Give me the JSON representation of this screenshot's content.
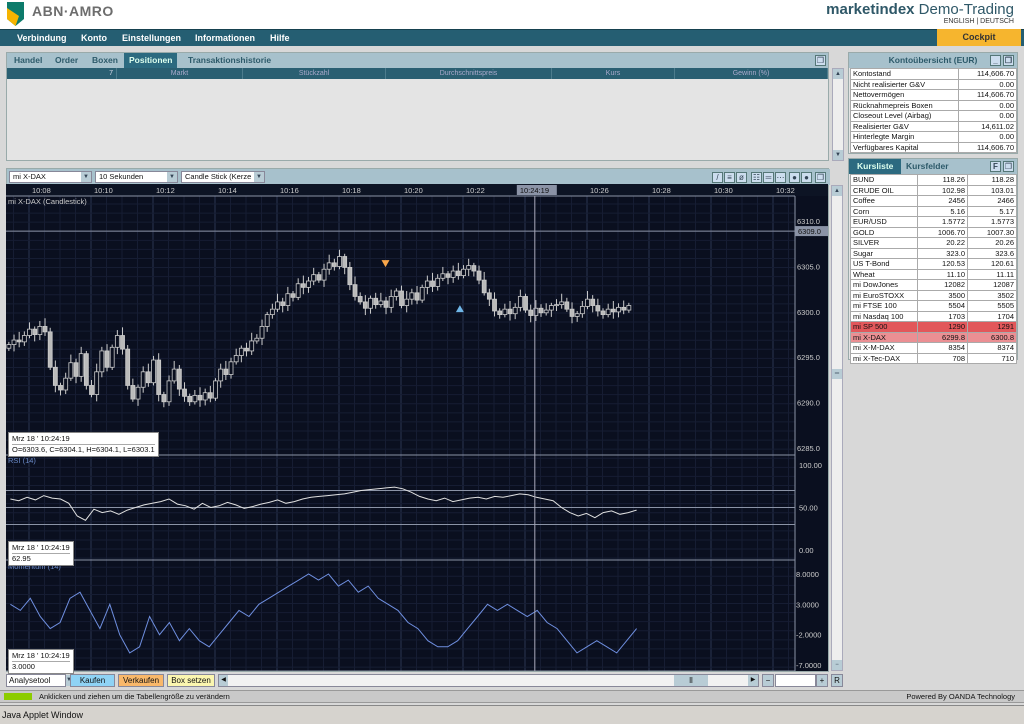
{
  "header": {
    "logo": "ABN·AMRO",
    "brand_bold": "marketindex",
    "brand_rest": " Demo-Trading",
    "lang_en": "ENGLISH",
    "lang_sep": " | ",
    "lang_de": "DEUTSCH"
  },
  "nav": [
    "Verbindung",
    "Konto",
    "Einstellungen",
    "Informationen",
    "Hilfe"
  ],
  "cockpit": "Cockpit",
  "positions": {
    "tabs": [
      "Handel",
      "Order",
      "Boxen",
      "Positionen",
      "Transaktionshistorie"
    ],
    "active": 3,
    "columns": [
      "7",
      "Markt",
      "Stückzahl",
      "Durchschnittspreis",
      "Kurs",
      "Gewinn (%)"
    ]
  },
  "konto": {
    "title": "Kontoübersicht (EUR)",
    "rows": [
      [
        "Kontostand",
        "114,606.70"
      ],
      [
        "Nicht realisierter G&V",
        "0.00"
      ],
      [
        "Nettovermögen",
        "114,606.70"
      ],
      [
        "Rücknahmepreis Boxen",
        "0.00"
      ],
      [
        "Closeout Level (Airbag)",
        "0.00"
      ],
      [
        "Realisierter G&V",
        "14,611.02"
      ],
      [
        "Hinterlegte Margin",
        "0.00"
      ],
      [
        "Verfügbares Kapital",
        "114,606.70"
      ]
    ]
  },
  "kurs": {
    "tabs": [
      "Kursliste",
      "Kursfelder"
    ],
    "f_label": "F",
    "rows": [
      [
        "BUND",
        "118.26",
        "118.28"
      ],
      [
        "CRUDE OIL",
        "102.98",
        "103.01"
      ],
      [
        "Coffee",
        "2456",
        "2466"
      ],
      [
        "Corn",
        "5.16",
        "5.17"
      ],
      [
        "EUR/USD",
        "1.5772",
        "1.5773"
      ],
      [
        "GOLD",
        "1006.70",
        "1007.30"
      ],
      [
        "SILVER",
        "20.22",
        "20.26"
      ],
      [
        "Sugar",
        "323.0",
        "323.6"
      ],
      [
        "US T-Bond",
        "120.53",
        "120.61"
      ],
      [
        "Wheat",
        "11.10",
        "11.11"
      ],
      [
        "mi DowJones",
        "12082",
        "12087"
      ],
      [
        "mi EuroSTOXX",
        "3500",
        "3502"
      ],
      [
        "mi FTSE 100",
        "5504",
        "5505"
      ],
      [
        "mi Nasdaq 100",
        "1703",
        "1704"
      ],
      [
        "mi SP 500",
        "1290",
        "1291"
      ],
      [
        "mi X-DAX",
        "6299.8",
        "6300.8"
      ],
      [
        "mi X-M-DAX",
        "8354",
        "8374"
      ],
      [
        "mi X-Tec-DAX",
        "708",
        "710"
      ]
    ],
    "highlight": {
      "14": "red",
      "15": "pink"
    }
  },
  "chart_controls": {
    "instrument": "mi X-DAX",
    "interval": "10 Sekunden",
    "type": "Candle Stick (Kerze"
  },
  "chart_data": {
    "type": "candlestick",
    "title": "mi X-DAX (Candlestick)",
    "time_ticks": [
      "10:08",
      "10:10",
      "10:12",
      "10:14",
      "10:16",
      "10:18",
      "10:20",
      "10:22",
      "10:26",
      "10:28",
      "10:30",
      "10:32"
    ],
    "crosshair_time": "10:24:19",
    "price_ticks": [
      "6310.0",
      "6305.0",
      "6300.0",
      "6295.0",
      "6290.0",
      "6285.0"
    ],
    "price_range": [
      6284,
      6312
    ],
    "level_label": "6309.0",
    "level": 6309,
    "start_minute": 7.35,
    "interval_seconds": 10,
    "closes": [
      6296.5,
      6297,
      6296.8,
      6297.5,
      6298.2,
      6297.6,
      6298.5,
      6297.9,
      6294,
      6292,
      6291.5,
      6292.8,
      6294.5,
      6293,
      6295.5,
      6292,
      6291,
      6293.5,
      6295.8,
      6294,
      6296.2,
      6297.5,
      6296,
      6292,
      6290.5,
      6291.8,
      6293.5,
      6292.3,
      6294.8,
      6291,
      6290.2,
      6292.5,
      6293.8,
      6291.6,
      6290.8,
      6290.2,
      6290.9,
      6290.4,
      6291.2,
      6290.6,
      6292.5,
      6293.8,
      6293.2,
      6294.6,
      6295.3,
      6296.1,
      6295.8,
      6296.9,
      6297.2,
      6298.5,
      6299.8,
      6300.4,
      6301.2,
      6300.8,
      6302.1,
      6301.7,
      6303.2,
      6302.8,
      6303.5,
      6304.2,
      6303.6,
      6304.8,
      6305.5,
      6305.1,
      6306.2,
      6305.0,
      6303.1,
      6301.8,
      6301.2,
      6300.5,
      6301.6,
      6300.9,
      6301.3,
      6300.6,
      6301.8,
      6302.4,
      6300.8,
      6301.5,
      6302.2,
      6301.4,
      6302.8,
      6303.5,
      6302.9,
      6303.8,
      6304.3,
      6303.9,
      6304.6,
      6304.1,
      6304.8,
      6305.2,
      6304.6,
      6303.6,
      6302.2,
      6301.5,
      6300.2,
      6299.8,
      6300.4,
      6299.9,
      6300.6,
      6301.8,
      6300.3,
      6299.7,
      6300.5,
      6300.0,
      6300.3,
      6300.8,
      6300.9,
      6301.2,
      6300.4,
      6299.6,
      6299.9,
      6300.7,
      6301.5,
      6300.8,
      6300.2,
      6299.8,
      6300.4,
      6300.1,
      6300.6,
      6300.3,
      6300.8
    ],
    "markers": [
      {
        "type": "sell",
        "minute": 19.5,
        "price": 6305.8
      },
      {
        "type": "buy",
        "minute": 21.9,
        "price": 6300.4
      }
    ],
    "tooltip": {
      "date": "Mrz 18 ' 10:24:19",
      "ohlc": "O=6303.6, C=6304.1, H=6304.1, L=6303.1"
    },
    "rsi": {
      "title": "RSI (14)",
      "ticks": [
        "100.00",
        "50.00",
        "0.00"
      ],
      "levels": [
        70,
        50,
        30
      ],
      "range": [
        0,
        100
      ],
      "tooltip_date": "Mrz 18 ' 10:24:19",
      "tooltip_value": "62.95",
      "values": [
        60,
        58,
        62,
        59,
        64,
        61,
        60,
        55,
        40,
        35,
        48,
        44,
        46,
        42,
        47,
        50,
        53,
        55,
        57,
        60,
        54,
        52,
        48,
        55,
        50,
        52,
        56,
        53,
        49,
        51,
        54,
        56,
        59,
        55,
        57,
        60,
        62,
        63,
        64,
        65,
        66,
        68,
        70,
        71,
        72,
        73,
        74,
        72,
        68,
        63,
        60,
        58,
        61,
        57,
        59,
        61,
        62,
        60,
        63,
        62,
        64,
        66,
        65,
        62,
        60,
        58,
        50,
        44,
        40,
        43,
        38,
        44,
        46,
        42,
        44,
        47
      ]
    },
    "momentum": {
      "title": "Momentum (14)",
      "ticks": [
        "8.0000",
        "3.0000",
        "-2.0000",
        "-7.0000"
      ],
      "range": [
        -7,
        8
      ],
      "tooltip_date": "Mrz 18 ' 10:24:19",
      "tooltip_value": "3.0000",
      "values": [
        3,
        2,
        4,
        1,
        -1,
        0,
        4,
        5,
        2,
        -1,
        3,
        -2,
        -5,
        -4,
        1,
        -2,
        0,
        -3,
        -1,
        -3,
        -4,
        -2,
        0,
        2,
        1,
        3,
        4,
        5,
        6,
        7,
        8,
        7,
        8,
        6,
        7,
        5,
        6,
        4,
        3,
        2,
        0,
        -1,
        -3,
        -4,
        -4,
        -3,
        -1,
        1,
        3,
        2,
        3,
        2,
        1,
        2,
        0,
        -1,
        -3,
        -5,
        -4,
        -3,
        -4,
        -5,
        -3,
        -1
      ]
    }
  },
  "bottom": {
    "analyse": "Analysetool",
    "kaufen": "Kaufen",
    "verkaufen": "Verkaufen",
    "box": "Box setzen",
    "reset": "R"
  },
  "status": {
    "text": "Anklicken und ziehen um die Tabellengröße zu verändern",
    "powered": "Powered By OANDA Technology"
  },
  "java": "Java Applet Window",
  "colors": {
    "nav": "#255e72",
    "cockpit": "#f6b52e",
    "chart_bg": "#0a0f1f",
    "kaufen": "#8fd3f5",
    "verkaufen": "#f9b86a",
    "box": "#fbf6b0"
  }
}
